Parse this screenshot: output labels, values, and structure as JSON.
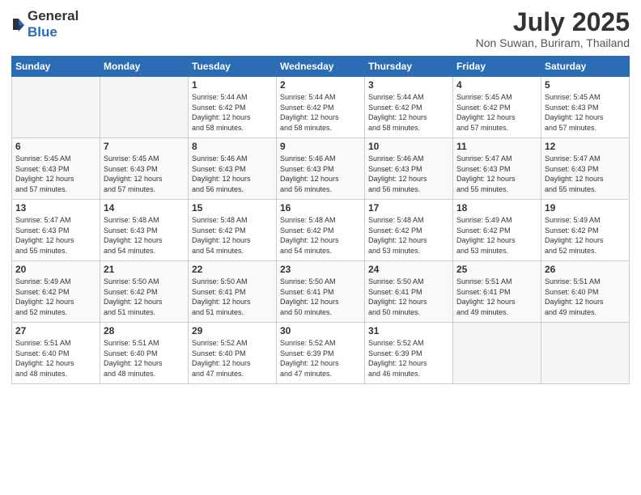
{
  "header": {
    "logo_general": "General",
    "logo_blue": "Blue",
    "title": "July 2025",
    "subtitle": "Non Suwan, Buriram, Thailand"
  },
  "weekdays": [
    "Sunday",
    "Monday",
    "Tuesday",
    "Wednesday",
    "Thursday",
    "Friday",
    "Saturday"
  ],
  "weeks": [
    [
      {
        "day": "",
        "info": ""
      },
      {
        "day": "",
        "info": ""
      },
      {
        "day": "1",
        "info": "Sunrise: 5:44 AM\nSunset: 6:42 PM\nDaylight: 12 hours\nand 58 minutes."
      },
      {
        "day": "2",
        "info": "Sunrise: 5:44 AM\nSunset: 6:42 PM\nDaylight: 12 hours\nand 58 minutes."
      },
      {
        "day": "3",
        "info": "Sunrise: 5:44 AM\nSunset: 6:42 PM\nDaylight: 12 hours\nand 58 minutes."
      },
      {
        "day": "4",
        "info": "Sunrise: 5:45 AM\nSunset: 6:42 PM\nDaylight: 12 hours\nand 57 minutes."
      },
      {
        "day": "5",
        "info": "Sunrise: 5:45 AM\nSunset: 6:43 PM\nDaylight: 12 hours\nand 57 minutes."
      }
    ],
    [
      {
        "day": "6",
        "info": "Sunrise: 5:45 AM\nSunset: 6:43 PM\nDaylight: 12 hours\nand 57 minutes."
      },
      {
        "day": "7",
        "info": "Sunrise: 5:45 AM\nSunset: 6:43 PM\nDaylight: 12 hours\nand 57 minutes."
      },
      {
        "day": "8",
        "info": "Sunrise: 5:46 AM\nSunset: 6:43 PM\nDaylight: 12 hours\nand 56 minutes."
      },
      {
        "day": "9",
        "info": "Sunrise: 5:46 AM\nSunset: 6:43 PM\nDaylight: 12 hours\nand 56 minutes."
      },
      {
        "day": "10",
        "info": "Sunrise: 5:46 AM\nSunset: 6:43 PM\nDaylight: 12 hours\nand 56 minutes."
      },
      {
        "day": "11",
        "info": "Sunrise: 5:47 AM\nSunset: 6:43 PM\nDaylight: 12 hours\nand 55 minutes."
      },
      {
        "day": "12",
        "info": "Sunrise: 5:47 AM\nSunset: 6:43 PM\nDaylight: 12 hours\nand 55 minutes."
      }
    ],
    [
      {
        "day": "13",
        "info": "Sunrise: 5:47 AM\nSunset: 6:43 PM\nDaylight: 12 hours\nand 55 minutes."
      },
      {
        "day": "14",
        "info": "Sunrise: 5:48 AM\nSunset: 6:43 PM\nDaylight: 12 hours\nand 54 minutes."
      },
      {
        "day": "15",
        "info": "Sunrise: 5:48 AM\nSunset: 6:42 PM\nDaylight: 12 hours\nand 54 minutes."
      },
      {
        "day": "16",
        "info": "Sunrise: 5:48 AM\nSunset: 6:42 PM\nDaylight: 12 hours\nand 54 minutes."
      },
      {
        "day": "17",
        "info": "Sunrise: 5:48 AM\nSunset: 6:42 PM\nDaylight: 12 hours\nand 53 minutes."
      },
      {
        "day": "18",
        "info": "Sunrise: 5:49 AM\nSunset: 6:42 PM\nDaylight: 12 hours\nand 53 minutes."
      },
      {
        "day": "19",
        "info": "Sunrise: 5:49 AM\nSunset: 6:42 PM\nDaylight: 12 hours\nand 52 minutes."
      }
    ],
    [
      {
        "day": "20",
        "info": "Sunrise: 5:49 AM\nSunset: 6:42 PM\nDaylight: 12 hours\nand 52 minutes."
      },
      {
        "day": "21",
        "info": "Sunrise: 5:50 AM\nSunset: 6:42 PM\nDaylight: 12 hours\nand 51 minutes."
      },
      {
        "day": "22",
        "info": "Sunrise: 5:50 AM\nSunset: 6:41 PM\nDaylight: 12 hours\nand 51 minutes."
      },
      {
        "day": "23",
        "info": "Sunrise: 5:50 AM\nSunset: 6:41 PM\nDaylight: 12 hours\nand 50 minutes."
      },
      {
        "day": "24",
        "info": "Sunrise: 5:50 AM\nSunset: 6:41 PM\nDaylight: 12 hours\nand 50 minutes."
      },
      {
        "day": "25",
        "info": "Sunrise: 5:51 AM\nSunset: 6:41 PM\nDaylight: 12 hours\nand 49 minutes."
      },
      {
        "day": "26",
        "info": "Sunrise: 5:51 AM\nSunset: 6:40 PM\nDaylight: 12 hours\nand 49 minutes."
      }
    ],
    [
      {
        "day": "27",
        "info": "Sunrise: 5:51 AM\nSunset: 6:40 PM\nDaylight: 12 hours\nand 48 minutes."
      },
      {
        "day": "28",
        "info": "Sunrise: 5:51 AM\nSunset: 6:40 PM\nDaylight: 12 hours\nand 48 minutes."
      },
      {
        "day": "29",
        "info": "Sunrise: 5:52 AM\nSunset: 6:40 PM\nDaylight: 12 hours\nand 47 minutes."
      },
      {
        "day": "30",
        "info": "Sunrise: 5:52 AM\nSunset: 6:39 PM\nDaylight: 12 hours\nand 47 minutes."
      },
      {
        "day": "31",
        "info": "Sunrise: 5:52 AM\nSunset: 6:39 PM\nDaylight: 12 hours\nand 46 minutes."
      },
      {
        "day": "",
        "info": ""
      },
      {
        "day": "",
        "info": ""
      }
    ]
  ]
}
